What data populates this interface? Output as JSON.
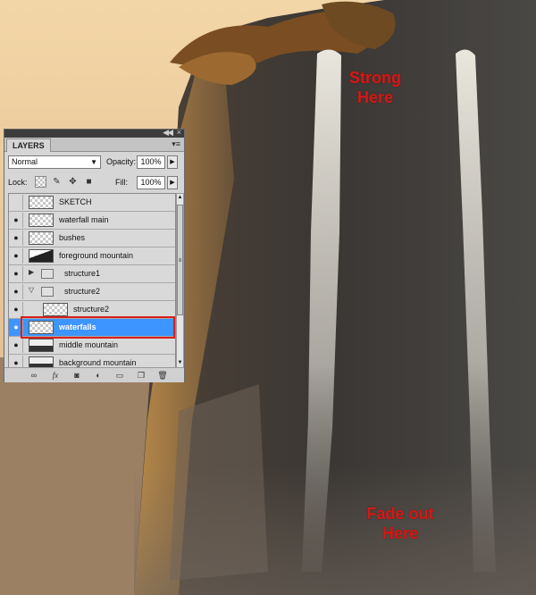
{
  "annotations": {
    "top": [
      "Strong",
      "Here"
    ],
    "bottom": [
      "Fade out",
      "Here"
    ]
  },
  "colors": {
    "annotation_red": "#d21a16",
    "selection_blue": "#3d95ff",
    "highlight_outline": "#d8201a"
  },
  "panel": {
    "tab_label": "LAYERS",
    "blend_mode": "Normal",
    "opacity_label": "Opacity:",
    "opacity_value": "100%",
    "lock_label": "Lock:",
    "fill_label": "Fill:",
    "fill_value": "100%",
    "layers": [
      {
        "name": "SKETCH",
        "visible": false,
        "kind": "layer",
        "thumb": "transparent"
      },
      {
        "name": "waterfall main",
        "visible": true,
        "kind": "layer",
        "thumb": "transparent"
      },
      {
        "name": "bushes",
        "visible": true,
        "kind": "layer",
        "thumb": "transparent"
      },
      {
        "name": "foreground mountain",
        "visible": true,
        "kind": "layer",
        "thumb": "dark"
      },
      {
        "name": "structure1",
        "visible": true,
        "kind": "group",
        "expanded": false
      },
      {
        "name": "structure2",
        "visible": true,
        "kind": "group",
        "expanded": true
      },
      {
        "name": "structure2",
        "visible": true,
        "kind": "sublayer",
        "thumb": "transparent"
      },
      {
        "name": "waterfalls",
        "visible": true,
        "kind": "layer",
        "thumb": "transparent",
        "selected": true
      },
      {
        "name": "middle mountain",
        "visible": true,
        "kind": "layer",
        "thumb": "dark2"
      },
      {
        "name": "background mountain",
        "visible": true,
        "kind": "layer",
        "thumb": "dark2"
      }
    ],
    "bottom_buttons": [
      "link-layers",
      "fx",
      "add-mask",
      "adjustment",
      "group",
      "new-layer",
      "delete"
    ]
  }
}
